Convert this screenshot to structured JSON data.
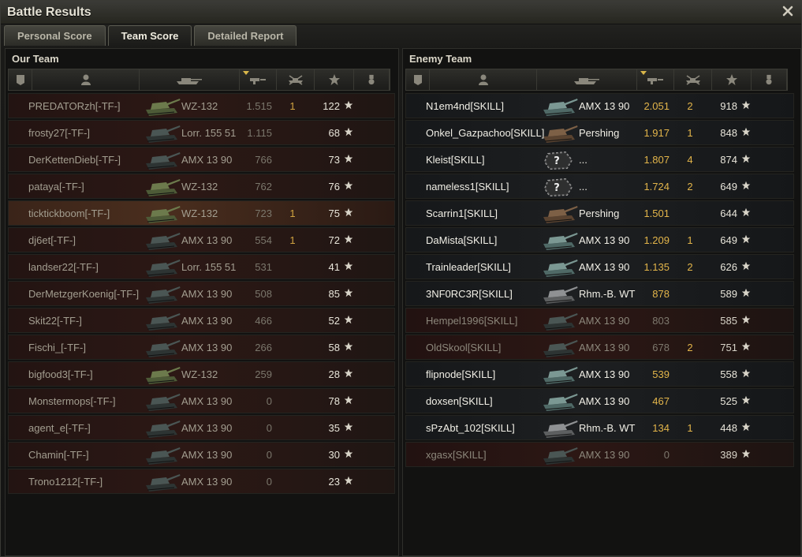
{
  "window": {
    "title": "Battle Results"
  },
  "tabs": [
    {
      "label": "Personal Score",
      "active": false
    },
    {
      "label": "Team Score",
      "active": true
    },
    {
      "label": "Detailed Report",
      "active": false
    }
  ],
  "our_team": {
    "title": "Our Team",
    "rows": [
      {
        "name": "PREDATORzh[-TF-]",
        "vehicle": "WZ-132",
        "damage": "1.515",
        "kills": "1",
        "xp": "122",
        "tank_color": "green"
      },
      {
        "name": "frosty27[-TF-]",
        "vehicle": "Lorr. 155 51",
        "damage": "1.115",
        "kills": "",
        "xp": "68",
        "tank_color": "dark"
      },
      {
        "name": "DerKettenDieb[-TF-]",
        "vehicle": "AMX 13 90",
        "damage": "766",
        "kills": "",
        "xp": "73",
        "tank_color": "dark"
      },
      {
        "name": "pataya[-TF-]",
        "vehicle": "WZ-132",
        "damage": "762",
        "kills": "",
        "xp": "76",
        "tank_color": "green"
      },
      {
        "name": "ticktickboom[-TF-]",
        "vehicle": "WZ-132",
        "damage": "723",
        "kills": "1",
        "xp": "75",
        "tank_color": "green",
        "highlight": true
      },
      {
        "name": "dj6et[-TF-]",
        "vehicle": "AMX 13 90",
        "damage": "554",
        "kills": "1",
        "xp": "72",
        "tank_color": "dark"
      },
      {
        "name": "landser22[-TF-]",
        "vehicle": "Lorr. 155 51",
        "damage": "531",
        "kills": "",
        "xp": "41",
        "tank_color": "dark"
      },
      {
        "name": "DerMetzgerKoenig[-TF-]",
        "vehicle": "AMX 13 90",
        "damage": "508",
        "kills": "",
        "xp": "85",
        "tank_color": "dark"
      },
      {
        "name": "Skit22[-TF-]",
        "vehicle": "AMX 13 90",
        "damage": "466",
        "kills": "",
        "xp": "52",
        "tank_color": "dark"
      },
      {
        "name": "Fischi_[-TF-]",
        "vehicle": "AMX 13 90",
        "damage": "266",
        "kills": "",
        "xp": "58",
        "tank_color": "dark"
      },
      {
        "name": "bigfood3[-TF-]",
        "vehicle": "WZ-132",
        "damage": "259",
        "kills": "",
        "xp": "28",
        "tank_color": "green"
      },
      {
        "name": "Monstermops[-TF-]",
        "vehicle": "AMX 13 90",
        "damage": "0",
        "kills": "",
        "xp": "78",
        "tank_color": "dark"
      },
      {
        "name": "agent_e[-TF-]",
        "vehicle": "AMX 13 90",
        "damage": "0",
        "kills": "",
        "xp": "35",
        "tank_color": "dark"
      },
      {
        "name": "Chamin[-TF-]",
        "vehicle": "AMX 13 90",
        "damage": "0",
        "kills": "",
        "xp": "30",
        "tank_color": "dark"
      },
      {
        "name": "Trono1212[-TF-]",
        "vehicle": "AMX 13 90",
        "damage": "0",
        "kills": "",
        "xp": "23",
        "tank_color": "dark"
      }
    ]
  },
  "enemy_team": {
    "title": "Enemy Team",
    "rows": [
      {
        "name": "N1em4nd[SKILL]",
        "vehicle": "AMX 13 90",
        "damage": "2.051",
        "kills": "2",
        "xp": "918",
        "tank_color": "teal",
        "state": "alive"
      },
      {
        "name": "Onkel_Gazpachoo[SKILL]",
        "vehicle": "Pershing",
        "damage": "1.917",
        "kills": "1",
        "xp": "848",
        "tank_color": "brown",
        "state": "alive"
      },
      {
        "name": "Kleist[SKILL]",
        "vehicle": "...",
        "damage": "1.807",
        "kills": "4",
        "xp": "874",
        "tank_color": "unknown",
        "state": "alive"
      },
      {
        "name": "nameless1[SKILL]",
        "vehicle": "...",
        "damage": "1.724",
        "kills": "2",
        "xp": "649",
        "tank_color": "unknown",
        "state": "alive"
      },
      {
        "name": "Scarrin1[SKILL]",
        "vehicle": "Pershing",
        "damage": "1.501",
        "kills": "",
        "xp": "644",
        "tank_color": "brown",
        "state": "alive"
      },
      {
        "name": "DaMista[SKILL]",
        "vehicle": "AMX 13 90",
        "damage": "1.209",
        "kills": "1",
        "xp": "649",
        "tank_color": "teal",
        "state": "alive"
      },
      {
        "name": "Trainleader[SKILL]",
        "vehicle": "AMX 13 90",
        "damage": "1.135",
        "kills": "2",
        "xp": "626",
        "tank_color": "teal",
        "state": "alive"
      },
      {
        "name": "3NF0RC3R[SKILL]",
        "vehicle": "Rhm.-B. WT",
        "damage": "878",
        "kills": "",
        "xp": "589",
        "tank_color": "grey",
        "state": "alive"
      },
      {
        "name": "Hempel1996[SKILL]",
        "vehicle": "AMX 13 90",
        "damage": "803",
        "kills": "",
        "xp": "585",
        "tank_color": "dark",
        "state": "dead"
      },
      {
        "name": "OldSkool[SKILL]",
        "vehicle": "AMX 13 90",
        "damage": "678",
        "kills": "2",
        "xp": "751",
        "tank_color": "dark",
        "state": "dead"
      },
      {
        "name": "flipnode[SKILL]",
        "vehicle": "AMX 13 90",
        "damage": "539",
        "kills": "",
        "xp": "558",
        "tank_color": "teal",
        "state": "alive"
      },
      {
        "name": "doxsen[SKILL]",
        "vehicle": "AMX 13 90",
        "damage": "467",
        "kills": "",
        "xp": "525",
        "tank_color": "teal",
        "state": "alive"
      },
      {
        "name": "sPzAbt_102[SKILL]",
        "vehicle": "Rhm.-B. WT",
        "damage": "134",
        "kills": "1",
        "xp": "448",
        "tank_color": "grey",
        "state": "alive"
      },
      {
        "name": "xgasx[SKILL]",
        "vehicle": "AMX 13 90",
        "damage": "0",
        "kills": "",
        "xp": "389",
        "tank_color": "dark",
        "state": "dead"
      }
    ]
  },
  "header_icons": [
    "squad-icon",
    "player-icon",
    "vehicle-icon",
    "damage-icon",
    "kills-icon",
    "xp-star-icon",
    "medal-icon"
  ],
  "colors": {
    "accent": "#e3b54a",
    "tab_active": "#1b1b19",
    "our_row": "#2c1815",
    "enemy_alive_row": "#1d1f21"
  }
}
